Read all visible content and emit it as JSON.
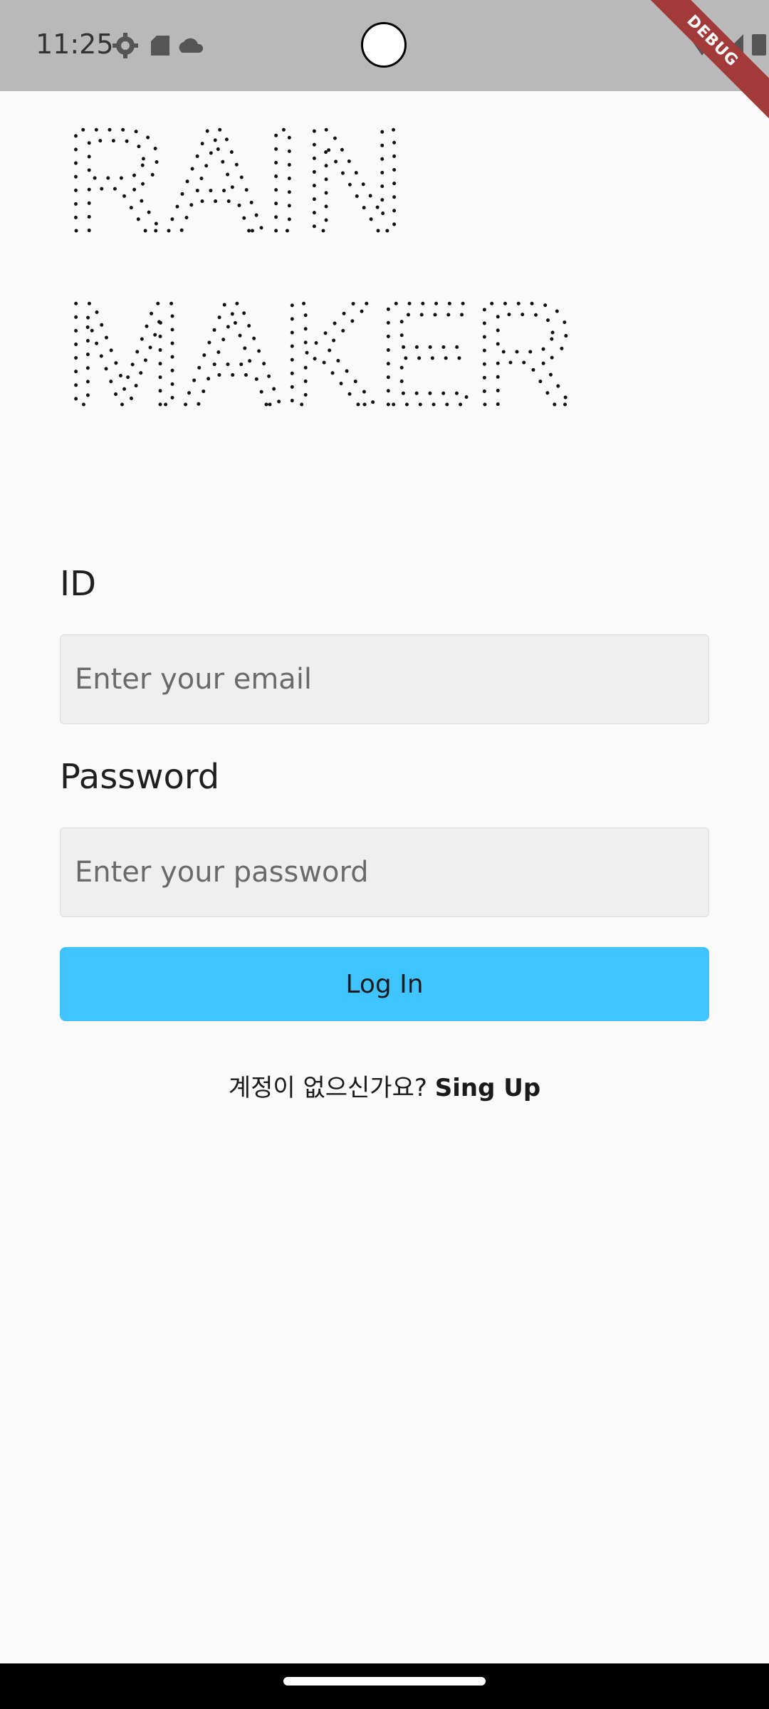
{
  "status_bar": {
    "time": "11:25",
    "left_icons": [
      "settings-gear-icon",
      "sd-card-icon",
      "cloud-icon"
    ],
    "right_icons": [
      "wifi-icon",
      "cell-signal-icon",
      "battery-icon"
    ],
    "debug_banner": "DEBUG",
    "colors": {
      "background": "#b9b9b9",
      "debug_ribbon": "#a33a3a"
    }
  },
  "logo": {
    "line1": "RAIN",
    "line2": "MAKER",
    "style": "dotted-outline"
  },
  "form": {
    "id_label": "ID",
    "id_placeholder": "Enter your email",
    "id_value": "",
    "password_label": "Password",
    "password_placeholder": "Enter your password",
    "password_value": "",
    "login_label": "Log In",
    "login_color": "#40c4ff"
  },
  "signup": {
    "prompt": "계정이 없으신가요?",
    "link": "Sing Up"
  }
}
